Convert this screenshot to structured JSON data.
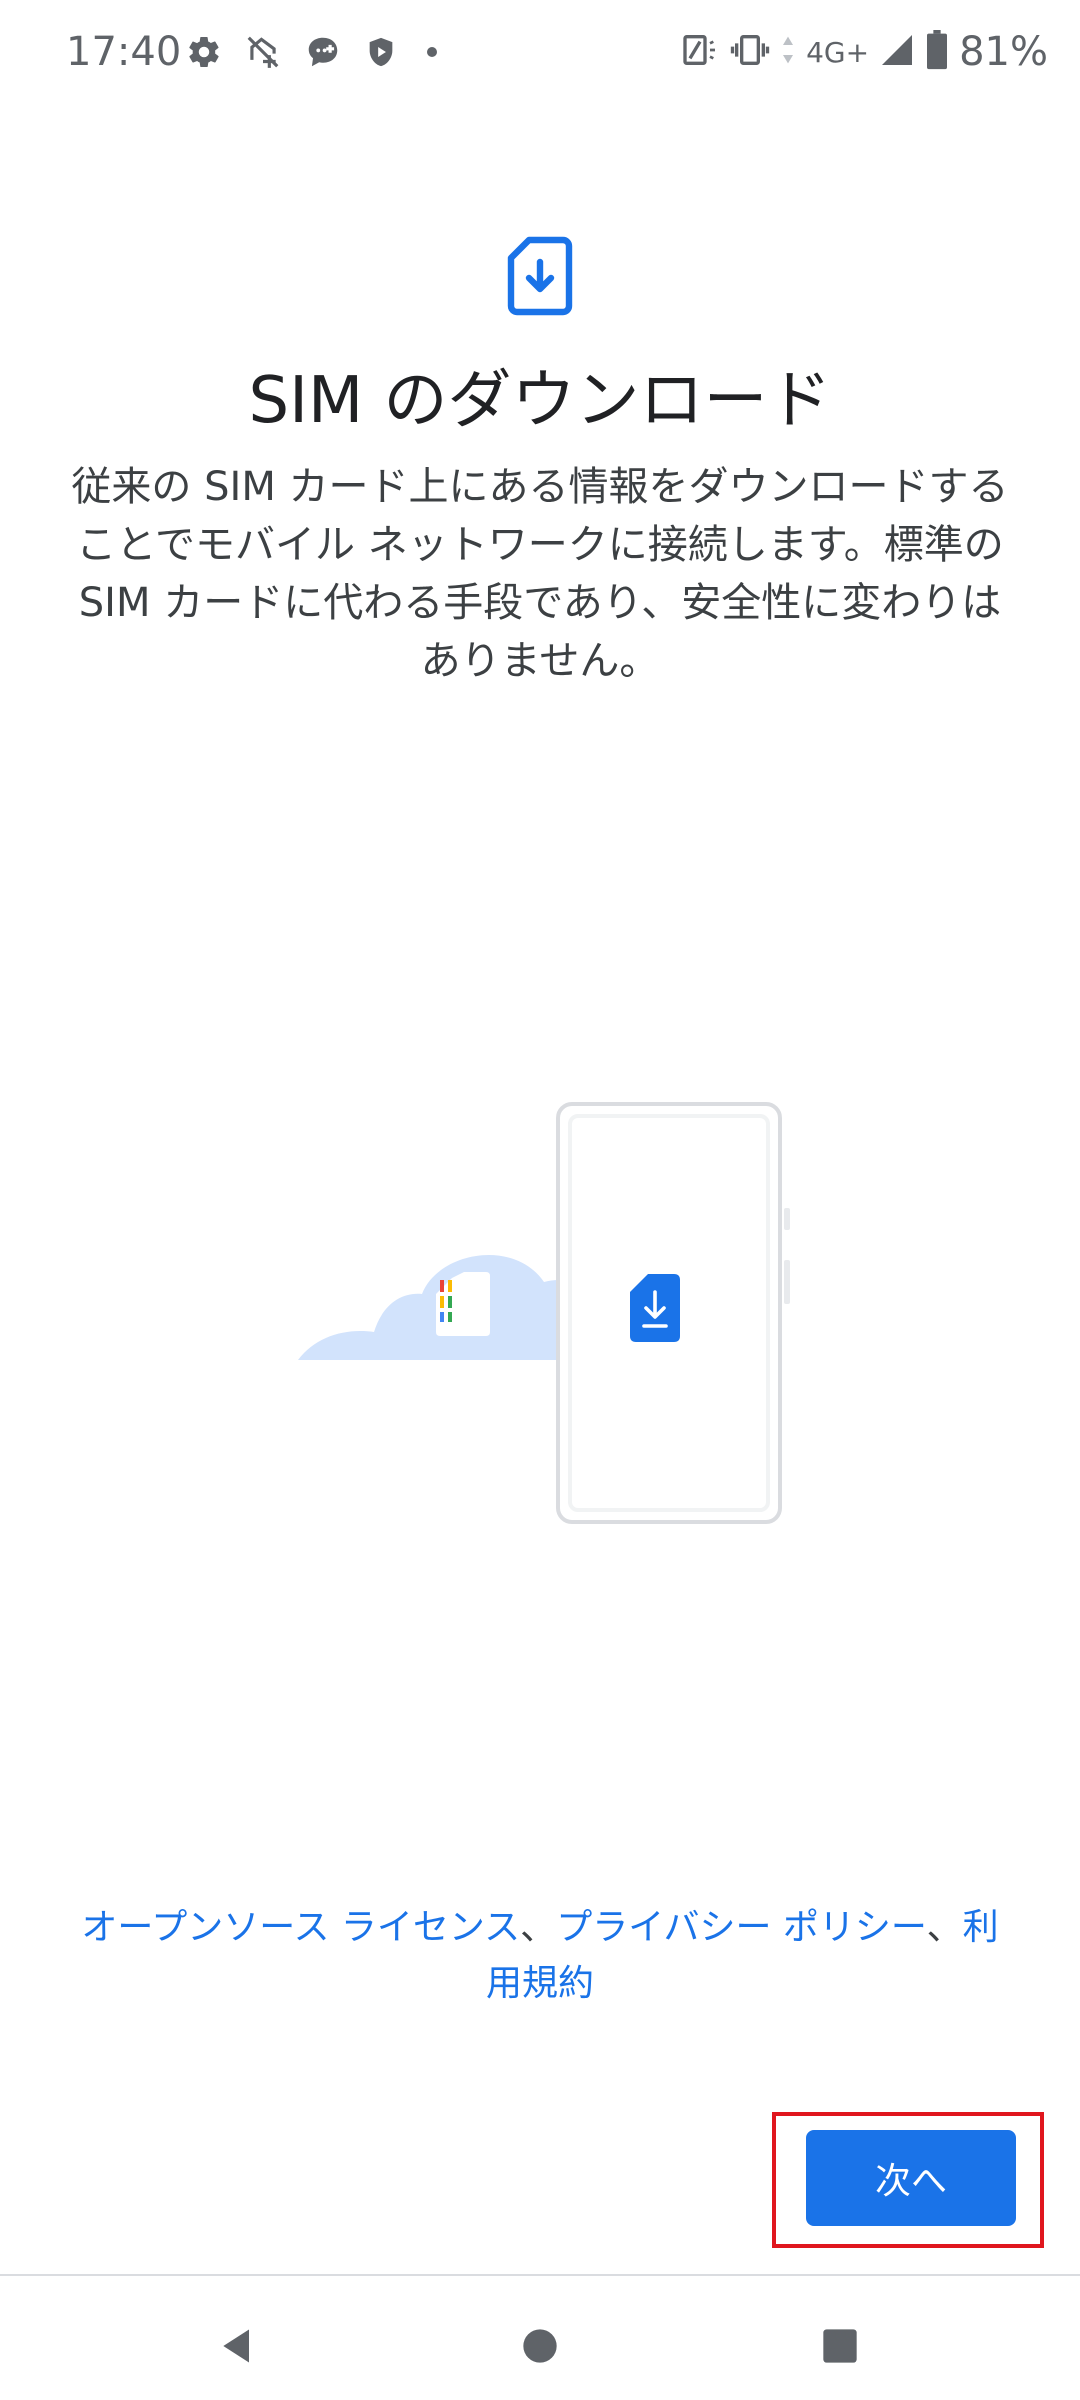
{
  "status_bar": {
    "time": "17:40",
    "network": "4G+",
    "battery": "81%",
    "left_icons": [
      "settings-icon",
      "no-data-icon",
      "chat-icon",
      "shield-play-icon",
      "dot-icon"
    ],
    "right_icons": [
      "nfc-icon",
      "vibrate-icon",
      "data-arrows-icon",
      "signal-icon",
      "battery-icon"
    ]
  },
  "header": {
    "icon": "sim-download-icon",
    "title": "SIM のダウンロード",
    "description": "従来の SIM カード上にある情報をダウンロードすることでモバイル ネットワークに接続します。標準の SIM カードに代わる手段であり、安全性に変わりはありません。"
  },
  "illustration": {
    "icons": [
      "cloud-icon",
      "sim-card-icon",
      "phone-icon",
      "sim-download-icon"
    ]
  },
  "legal": {
    "open_source": "オープンソース ライセンス",
    "separator1": "、",
    "privacy": "プライバシー ポリシー",
    "separator2": "、",
    "terms": "利用規約"
  },
  "actions": {
    "next": "次へ"
  },
  "nav": {
    "icons": [
      "back-icon",
      "home-icon",
      "recents-icon"
    ]
  },
  "colors": {
    "accent": "#1a73e8",
    "highlight": "#e0161e",
    "cloud": "#d2e3fc"
  }
}
